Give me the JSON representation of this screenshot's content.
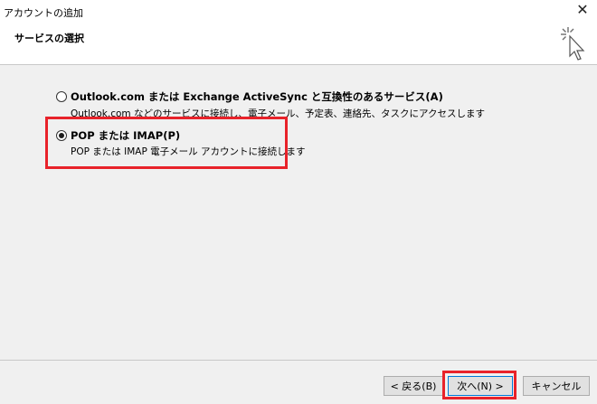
{
  "window": {
    "title": "アカウントの追加",
    "close_glyph": "✕"
  },
  "header": {
    "section_title": "サービスの選択"
  },
  "options": [
    {
      "label": "Outlook.com または Exchange ActiveSync と互換性のあるサービス(A)",
      "description": "Outlook.com などのサービスに接続し、電子メール、予定表、連絡先、タスクにアクセスします",
      "selected": false
    },
    {
      "label": "POP または IMAP(P)",
      "description": "POP または IMAP 電子メール アカウントに接続します",
      "selected": true
    }
  ],
  "buttons": {
    "back": "< 戻る(B)",
    "next": "次へ(N) >",
    "cancel": "キャンセル"
  },
  "colors": {
    "highlight": "#e8222a",
    "accent": "#0078d7"
  }
}
